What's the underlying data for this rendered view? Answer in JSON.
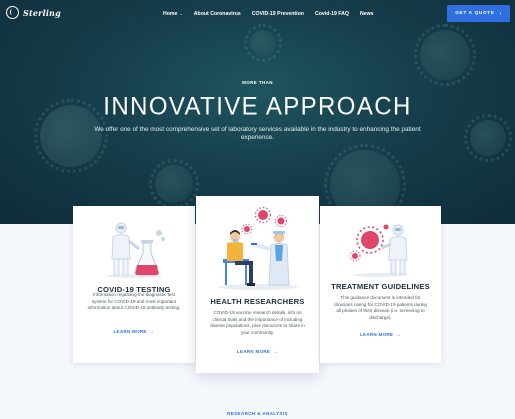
{
  "brand": {
    "name": "Sterling"
  },
  "nav": {
    "items": [
      {
        "label": "Home",
        "has_dropdown": true
      },
      {
        "label": "About Coronavirus"
      },
      {
        "label": "COVID-19 Prevention"
      },
      {
        "label": "Covid-19 FAQ"
      },
      {
        "label": "News"
      }
    ],
    "cta_label": "GET A QUOTE",
    "cta_icon": "arrow-right-icon"
  },
  "hero": {
    "kicker": "MORE THAN",
    "title": "INNOVATIVE APPROACH",
    "subtitle": "We offer one of the most comprehensive set of laboratory services available in the industry to enhancing the patient experience."
  },
  "cards": [
    {
      "title": "COVID-19 TESTING",
      "body": "Information regarding the diagnostic test system for COVID-19 and most important information about COVID-19 antibody testing.",
      "link": "LEARN MORE"
    },
    {
      "title": "HEALTH RESEARCHERS",
      "body": "COVID-19 vaccine research details, info on clinical trials and the importance of including diverse populations, plus resources to share in your community.",
      "link": "LEARN MORE"
    },
    {
      "title": "TREATMENT GUIDELINES",
      "body": "This guidance document is intended for clinicians caring for COVID-19 patients during all phases of their disease (i.e. screening to discharge).",
      "link": "LEARN MORE"
    }
  ],
  "section": {
    "kicker": "RESEARCH & ANALYSIS"
  },
  "colors": {
    "accent": "#2f6fe0",
    "hero_bg": "#163e4c",
    "virus_red": "#e0456a"
  }
}
